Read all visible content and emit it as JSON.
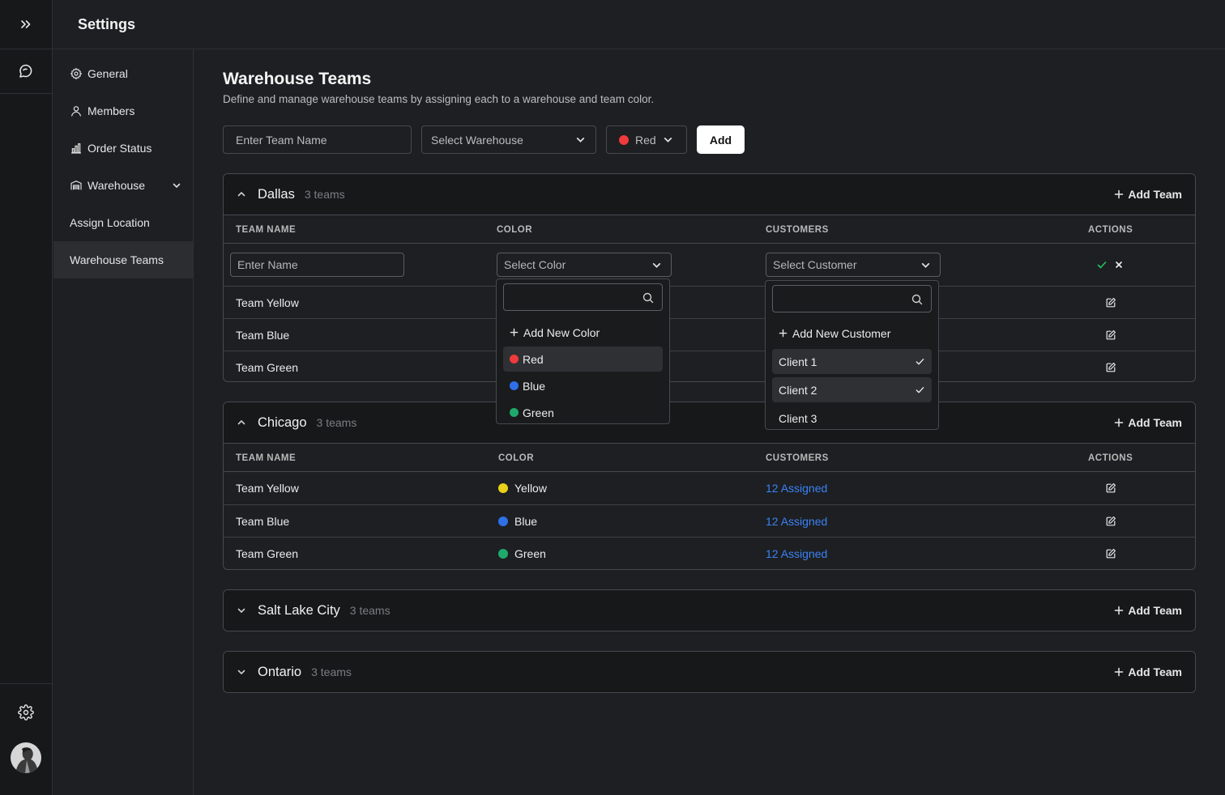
{
  "app": {
    "title": "Settings"
  },
  "colors": {
    "red": "#ef3b3b",
    "blue": "#2f6fe8",
    "green": "#1faa6b",
    "yellow": "#e9d11a",
    "link": "#3b82f6"
  },
  "rail": {
    "top_icon": "chevrons-right-icon",
    "chat_icon": "chat-icon",
    "settings_icon": "gear-icon",
    "avatar": "avatar"
  },
  "sidebar": {
    "items": [
      {
        "label": "General",
        "icon": "gear-icon"
      },
      {
        "label": "Members",
        "icon": "user-icon"
      },
      {
        "label": "Order Status",
        "icon": "bar-chart-icon"
      },
      {
        "label": "Warehouse",
        "icon": "warehouse-icon"
      },
      {
        "label": "Assign Location"
      },
      {
        "label": "Warehouse Teams"
      }
    ]
  },
  "page": {
    "title": "Warehouse Teams",
    "description": "Define and manage warehouse teams by assigning each to a warehouse and team color."
  },
  "form": {
    "team_name_placeholder": "Enter Team Name",
    "warehouse_placeholder": "Select Warehouse",
    "color_value": "Red",
    "add_label": "Add"
  },
  "table_headers": {
    "team_name": "TEAM NAME",
    "color": "COLOR",
    "customers": "CUSTOMERS",
    "actions": "ACTIONS"
  },
  "add_team_label": "Add Team",
  "sections": [
    {
      "name": "Dallas",
      "count": "3 teams",
      "new_row": {
        "name_placeholder": "Enter Name",
        "color_placeholder": "Select Color",
        "customer_placeholder": "Select Customer"
      },
      "rows": [
        {
          "name": "Team Yellow"
        },
        {
          "name": "Team Blue"
        },
        {
          "name": "Team Green"
        }
      ]
    },
    {
      "name": "Chicago",
      "count": "3 teams",
      "rows": [
        {
          "name": "Team Yellow",
          "color": "Yellow",
          "customers": "12 Assigned"
        },
        {
          "name": "Team Blue",
          "color": "Blue",
          "customers": "12 Assigned"
        },
        {
          "name": "Team Green",
          "color": "Green",
          "customers": "12 Assigned"
        }
      ]
    },
    {
      "name": "Salt Lake City",
      "count": "3 teams"
    },
    {
      "name": "Ontario",
      "count": "3 teams"
    }
  ],
  "color_dropdown": {
    "add_label": "Add New Color",
    "options": [
      {
        "label": "Red"
      },
      {
        "label": "Blue"
      },
      {
        "label": "Green"
      }
    ]
  },
  "customer_dropdown": {
    "add_label": "Add New Customer",
    "options": [
      {
        "label": "Client 1",
        "checked": true
      },
      {
        "label": "Client 2",
        "checked": true
      },
      {
        "label": "Client 3",
        "checked": false
      }
    ]
  }
}
